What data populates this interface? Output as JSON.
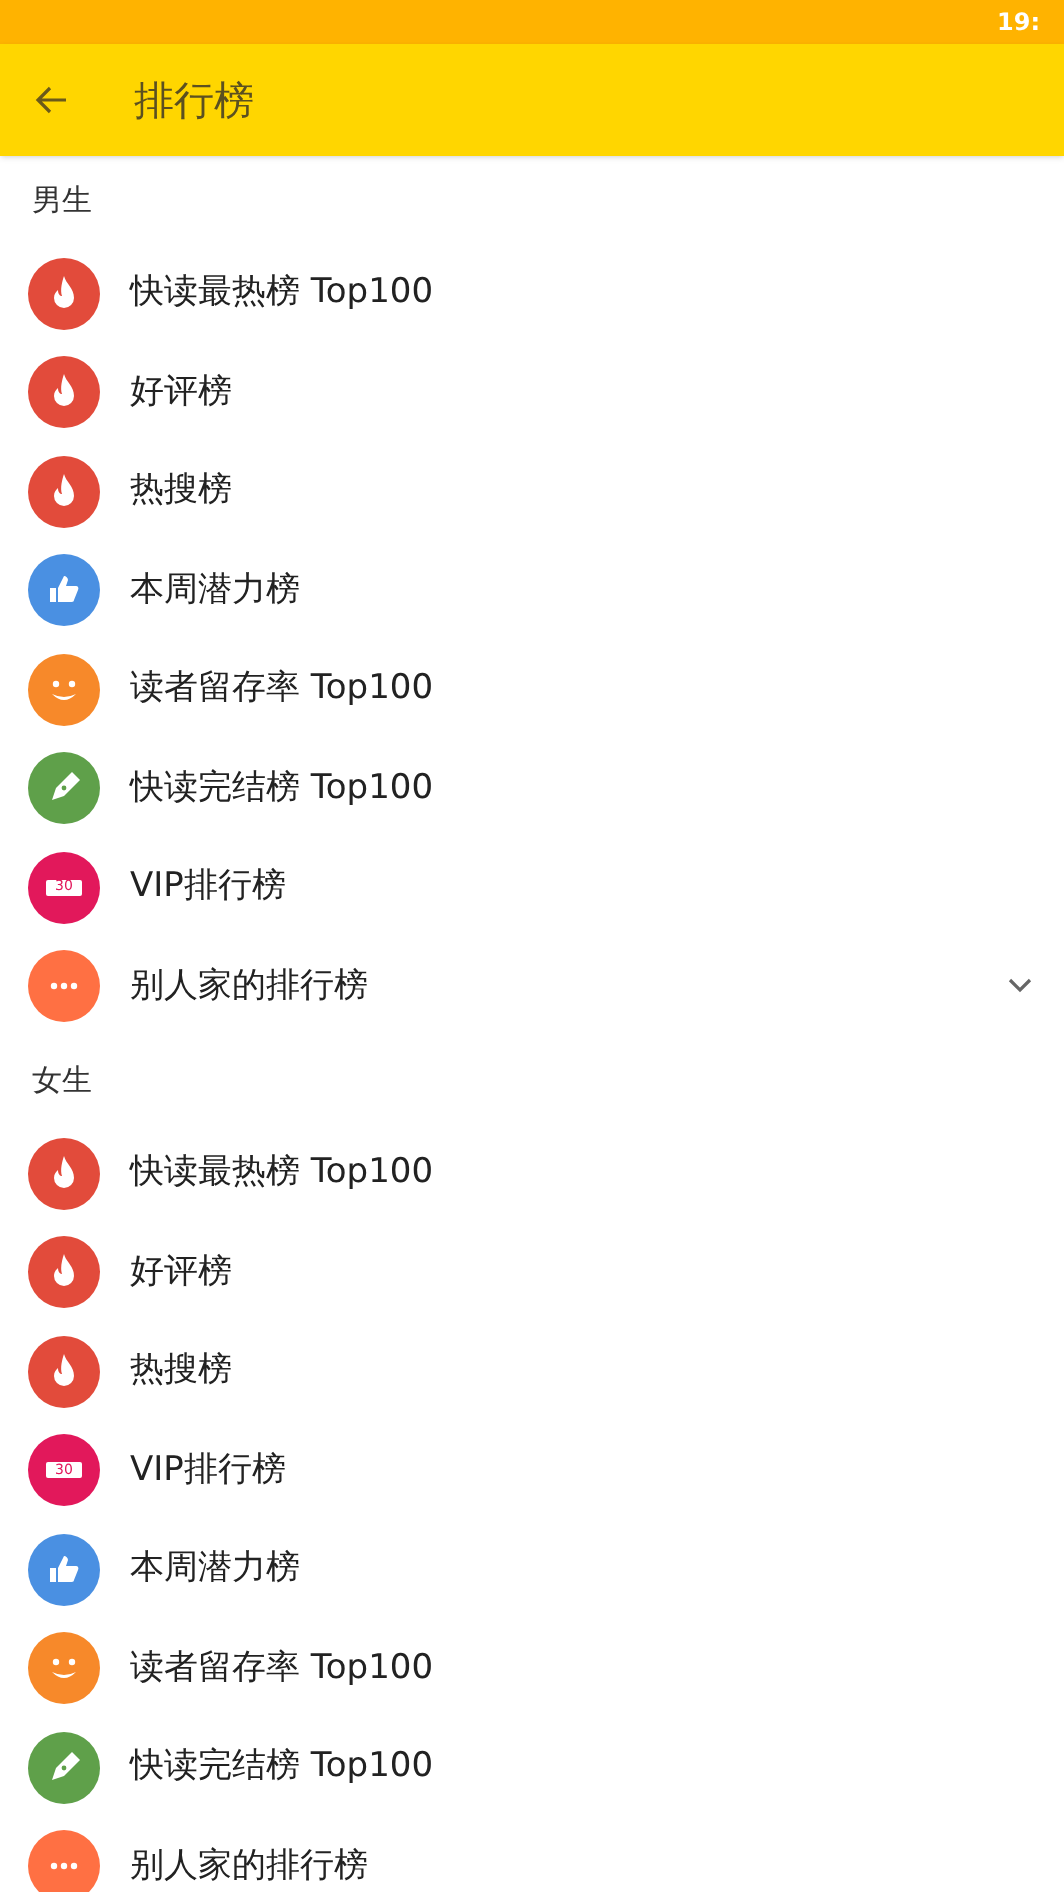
{
  "status_bar": {
    "time": "19:"
  },
  "toolbar": {
    "title": "排行榜"
  },
  "sections": [
    {
      "title": "男生",
      "items": [
        {
          "label": "快读最热榜 Top100",
          "kind": "fire",
          "expandable": false
        },
        {
          "label": "好评榜",
          "kind": "fire",
          "expandable": false
        },
        {
          "label": "热搜榜",
          "kind": "fire",
          "expandable": false
        },
        {
          "label": "本周潜力榜",
          "kind": "thumb",
          "expandable": false
        },
        {
          "label": "读者留存率 Top100",
          "kind": "smile",
          "expandable": false
        },
        {
          "label": "快读完结榜 Top100",
          "kind": "pen",
          "expandable": false
        },
        {
          "label": "VIP排行榜",
          "kind": "ticket",
          "icon_text": "30",
          "expandable": false
        },
        {
          "label": "别人家的排行榜",
          "kind": "more",
          "expandable": true
        }
      ]
    },
    {
      "title": "女生",
      "items": [
        {
          "label": "快读最热榜 Top100",
          "kind": "fire",
          "expandable": false
        },
        {
          "label": "好评榜",
          "kind": "fire",
          "expandable": false
        },
        {
          "label": "热搜榜",
          "kind": "fire",
          "expandable": false
        },
        {
          "label": "VIP排行榜",
          "kind": "ticket",
          "icon_text": "30",
          "expandable": false
        },
        {
          "label": "本周潜力榜",
          "kind": "thumb",
          "expandable": false
        },
        {
          "label": "读者留存率 Top100",
          "kind": "smile",
          "expandable": false
        },
        {
          "label": "快读完结榜 Top100",
          "kind": "pen",
          "expandable": false
        },
        {
          "label": "别人家的排行榜",
          "kind": "more",
          "expandable": false
        }
      ]
    }
  ]
}
